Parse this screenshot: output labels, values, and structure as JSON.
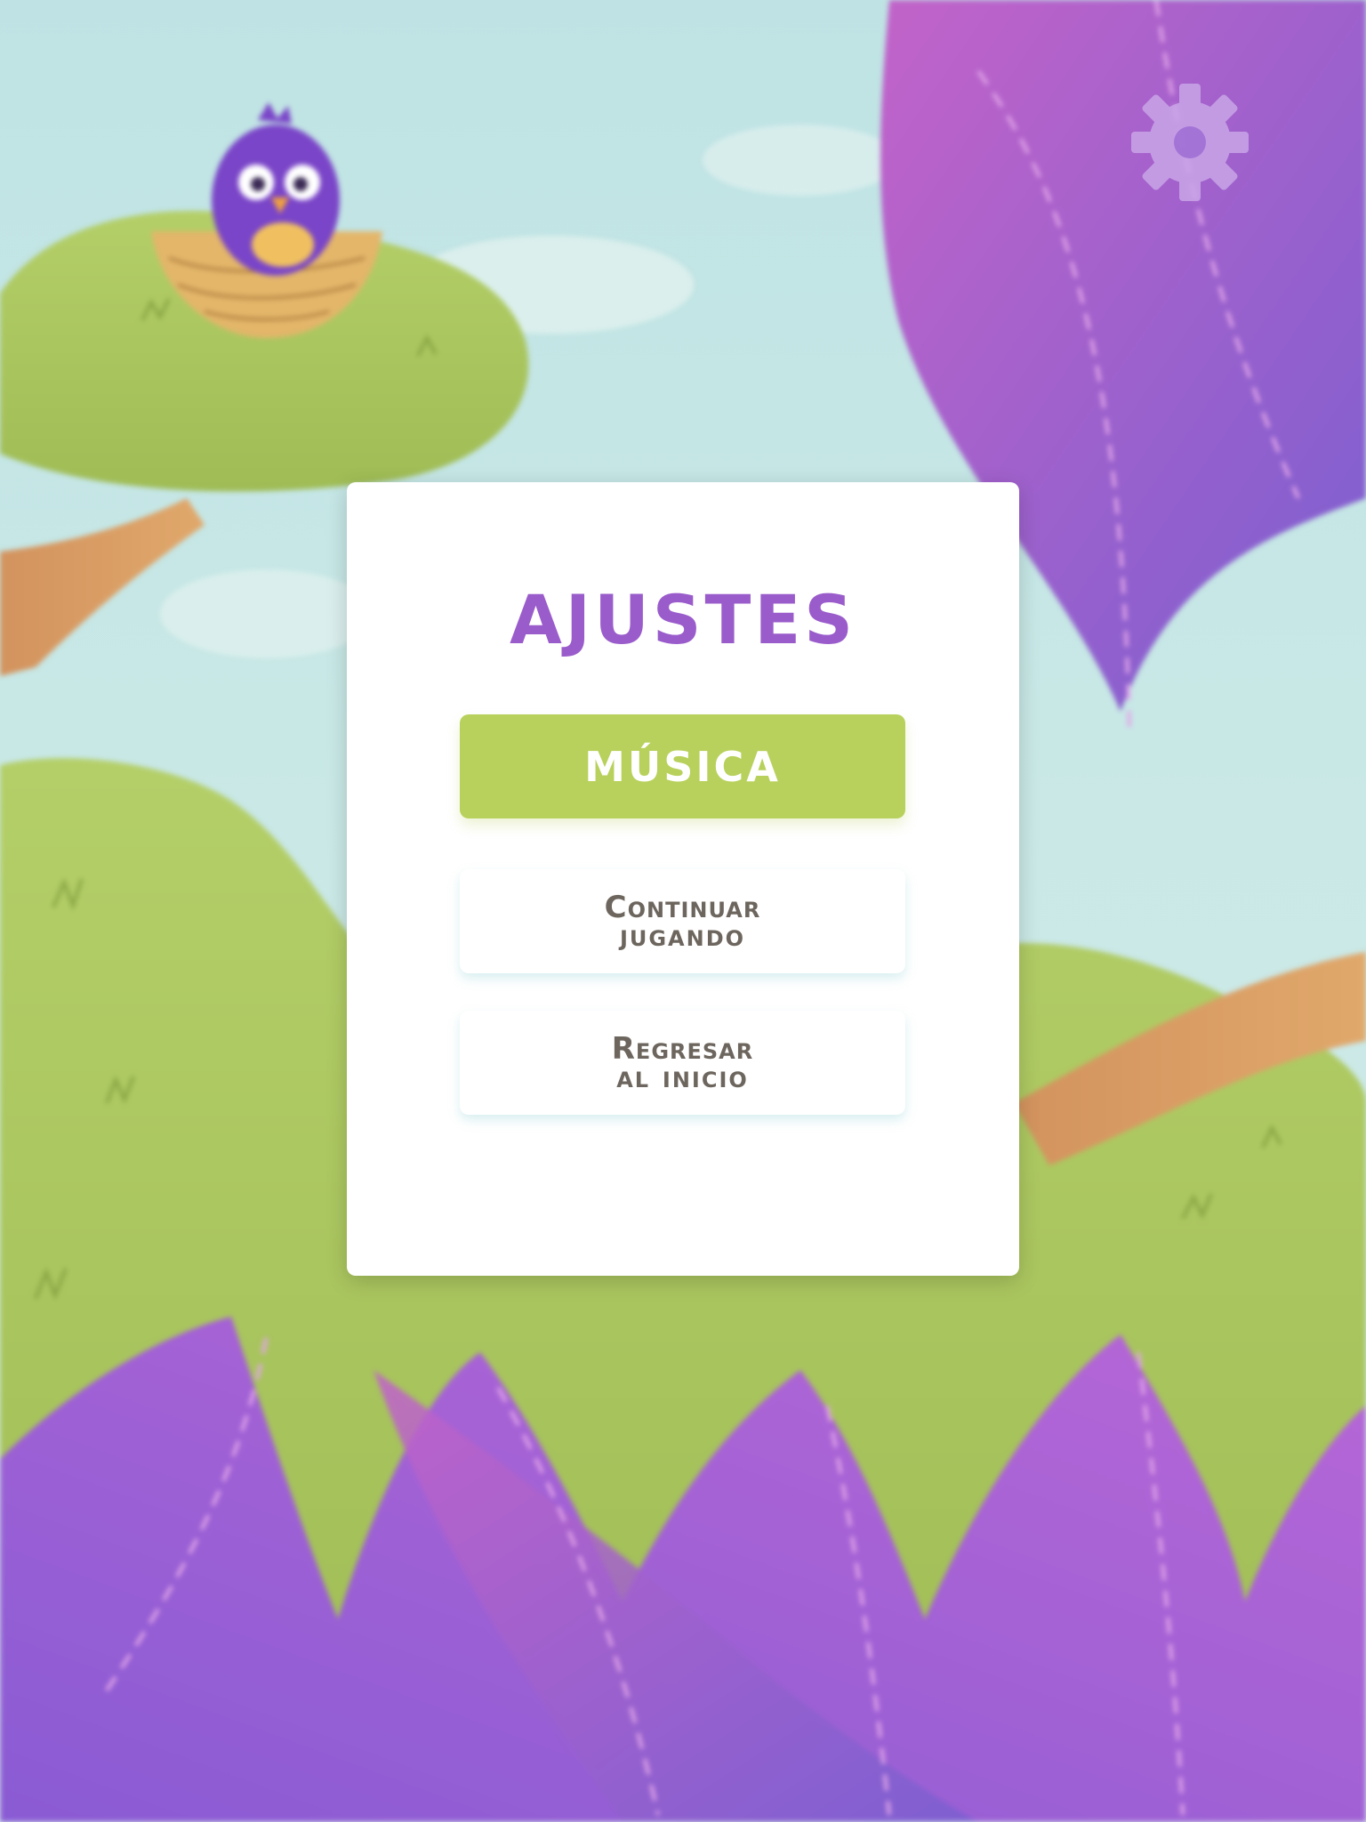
{
  "settings_modal": {
    "title": "AJUSTES",
    "music_button": "MÚSICA",
    "continue_button": {
      "line1": "Continuar",
      "line2": "jugando"
    },
    "return_button": {
      "line1": "Regresar",
      "line2": "al inicio"
    }
  },
  "icons": {
    "settings": "gear-icon",
    "character": "bird-in-nest"
  },
  "colors": {
    "title": "#9a5ccb",
    "music_button_bg": "#b8d15c",
    "button_text": "#6d665e",
    "leaf": "#a15fd0",
    "bush": "#a8c25a"
  }
}
